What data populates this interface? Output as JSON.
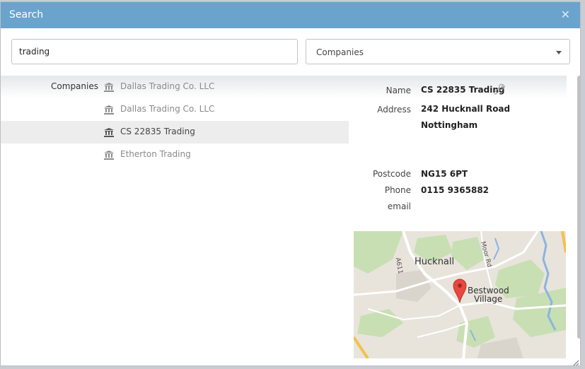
{
  "dialog": {
    "title": "Search",
    "close_icon": "close-icon"
  },
  "search": {
    "value": "trading"
  },
  "type_select": {
    "selected": "Companies"
  },
  "results": {
    "group_label": "Companies",
    "items": [
      {
        "name": "Dallas Trading Co. LLC",
        "icon": "bank-icon",
        "selected": false
      },
      {
        "name": "Dallas Trading Co. LLC",
        "icon": "bank-icon",
        "selected": false
      },
      {
        "name": "CS 22835 Trading",
        "icon": "bank-icon",
        "selected": true
      },
      {
        "name": "Etherton Trading",
        "icon": "bank-icon",
        "selected": false
      }
    ]
  },
  "details": {
    "name_label": "Name",
    "name_value": "CS 22835 Trading",
    "address_label": "Address",
    "address_line1": "242 Hucknall Road",
    "address_line2": "Nottingham",
    "postcode_label": "Postcode",
    "postcode_value": "NG15 6PT",
    "phone_label": "Phone",
    "phone_value": "0115 9365882",
    "email_label": "email",
    "edit_icon": "wrench-icon"
  },
  "map": {
    "town": "Hucknall",
    "village_line1": "Bestwood",
    "village_line2": "Village",
    "road_a611": "A611",
    "road_moor": "Moor Rd",
    "marker_icon": "map-pin-icon",
    "colors": {
      "land": "#e8e4dc",
      "green": "#c8dfb3",
      "water": "#8ab4e0",
      "road": "#ffffff",
      "major_road": "#f2c14e",
      "pin": "#e8483f"
    }
  }
}
